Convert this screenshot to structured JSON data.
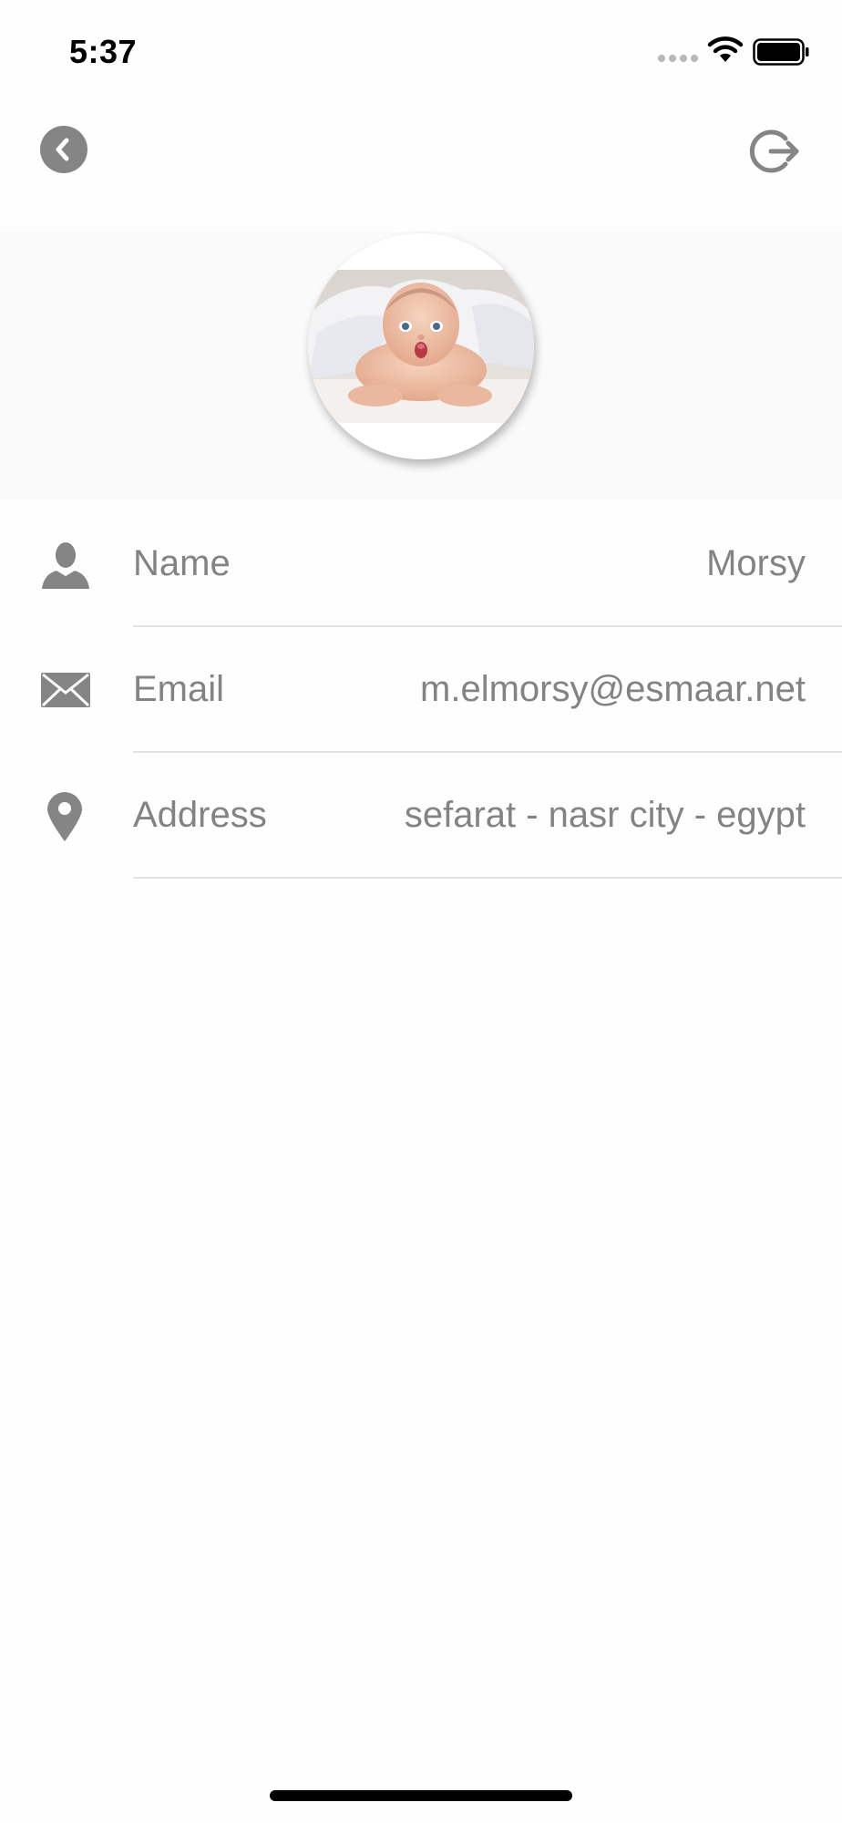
{
  "status_bar": {
    "time": "5:37",
    "icons": [
      "signal-icon",
      "wifi-icon",
      "battery-icon"
    ]
  },
  "navigation": {
    "back_icon": "chevron-left-icon",
    "logout_icon": "logout-icon"
  },
  "profile": {
    "avatar": "baby-photo"
  },
  "fields": [
    {
      "icon": "person-icon",
      "label": "Name",
      "value": "Morsy"
    },
    {
      "icon": "envelope-icon",
      "label": "Email",
      "value": "m.elmorsy@esmaar.net"
    },
    {
      "icon": "location-pin-icon",
      "label": "Address",
      "value": "sefarat - nasr city - egypt"
    }
  ],
  "colors": {
    "text_gray": "#838383",
    "icon_gray": "#858585",
    "divider": "#e3e3e3",
    "header_bg": "#fafafa"
  }
}
